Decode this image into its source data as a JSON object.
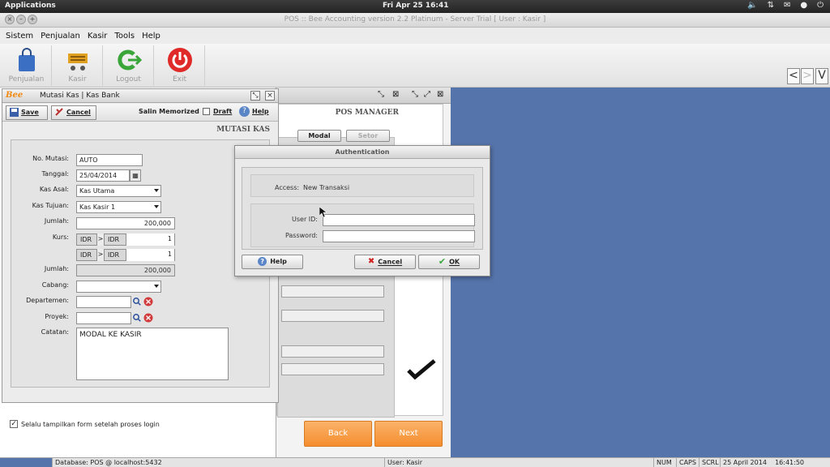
{
  "system_bar": {
    "applications_label": "Applications",
    "clock": "Fri Apr 25 16:41",
    "tray_icons": [
      "volume-icon",
      "network-icon",
      "mail-icon",
      "user-icon",
      "power-icon"
    ]
  },
  "window": {
    "title": "POS :: Bee Accounting version 2.2 Platinum - Server Trial [ User : Kasir ]"
  },
  "menu": {
    "items": [
      "Sistem",
      "Penjualan",
      "Kasir",
      "Tools",
      "Help"
    ]
  },
  "toolbar": {
    "buttons": [
      {
        "label": "Penjualan",
        "icon": "shopping-bag-icon"
      },
      {
        "label": "Kasir",
        "icon": "cash-register-icon"
      },
      {
        "label": "Logout",
        "icon": "logout-icon"
      },
      {
        "label": "Exit",
        "icon": "power-icon"
      }
    ],
    "nav": {
      "prev": "<",
      "next": ">",
      "more": "V"
    }
  },
  "pos_manager": {
    "title": "POS MANAGER",
    "modal_label": "Modal",
    "setor_label": "Setor",
    "back_label": "Back",
    "next_label": "Next",
    "checkbox_label": "Selalu tampilkan form setelah proses login"
  },
  "mutasi_kas": {
    "window_title": "Mutasi Kas | Kas Bank",
    "logo": "Bee",
    "save_label": "Save",
    "cancel_label": "Cancel",
    "salin_label": "Salin Memorized",
    "draft_label": "Draft",
    "help_label": "Help",
    "section_title": "MUTASI KAS",
    "fields": {
      "no_mutasi_label": "No. Mutasi:",
      "no_mutasi_value": "AUTO",
      "tanggal_label": "Tanggal:",
      "tanggal_value": "25/04/2014",
      "kas_asal_label": "Kas Asal:",
      "kas_asal_value": "Kas Utama",
      "kas_tujuan_label": "Kas Tujuan:",
      "kas_tujuan_value": "Kas Kasir 1",
      "jumlah_label": "Jumlah:",
      "jumlah_value": "200,000",
      "kurs_label": "Kurs:",
      "kurs_from": "IDR",
      "kurs_gt": ">",
      "kurs_to": "IDR",
      "kurs_value_1": "1",
      "kurs_value_2": "1",
      "jumlah2_label": "Jumlah:",
      "jumlah2_value": "200,000",
      "cabang_label": "Cabang:",
      "cabang_value": "",
      "departemen_label": "Departemen:",
      "departemen_value": "",
      "proyek_label": "Proyek:",
      "proyek_value": "",
      "catatan_label": "Catatan:",
      "catatan_value": "MODAL KE KASIR"
    }
  },
  "auth_dialog": {
    "title": "Authentication",
    "access_label": "Access:",
    "access_value": "New Transaksi",
    "user_id_label": "User ID:",
    "password_label": "Password:",
    "help_label": "Help",
    "cancel_label": "Cancel",
    "ok_label": "OK"
  },
  "status_bar": {
    "database": "Database: POS @ localhost:5432",
    "user": "User: Kasir",
    "num": "NUM",
    "caps": "CAPS",
    "scrl": "SCRL",
    "datetime": "25 April 2014    16:41:50"
  },
  "colors": {
    "workspace": "#5574ab",
    "orange_button": "#f48d2e",
    "logo": "#f08a10"
  }
}
